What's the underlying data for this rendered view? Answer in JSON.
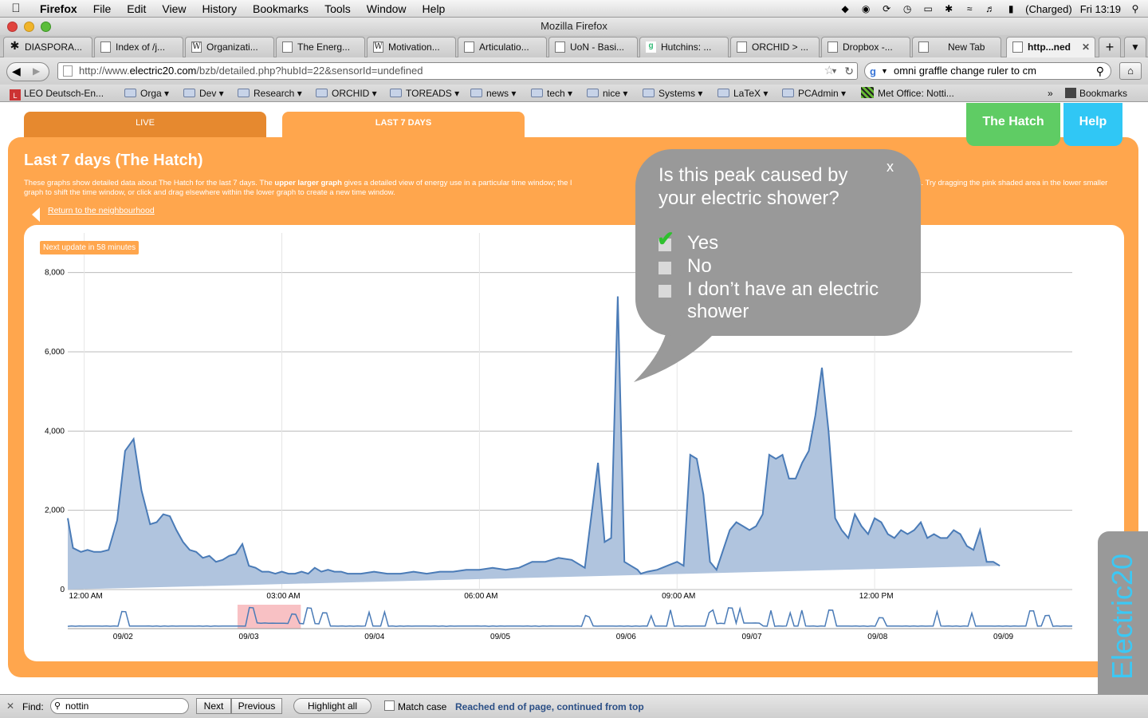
{
  "menubar": {
    "app": "Firefox",
    "items": [
      "File",
      "Edit",
      "View",
      "History",
      "Bookmarks",
      "Tools",
      "Window",
      "Help"
    ],
    "battery": "(Charged)",
    "clock": "Fri 13:19"
  },
  "window": {
    "title": "Mozilla Firefox"
  },
  "tabs": [
    {
      "label": "DIASPORA...",
      "icon": "asterisk-icon"
    },
    {
      "label": "Index of /j...",
      "icon": "page-icon"
    },
    {
      "label": "Organizati...",
      "icon": "wikipedia-icon"
    },
    {
      "label": "The Energ...",
      "icon": "page-icon"
    },
    {
      "label": "Motivation...",
      "icon": "wikipedia-icon"
    },
    {
      "label": "Articulatio...",
      "icon": "page-icon"
    },
    {
      "label": "UoN - Basi...",
      "icon": "page-icon"
    },
    {
      "label": "Hutchins: ...",
      "icon": "google-icon"
    },
    {
      "label": "ORCHID > ...",
      "icon": "page-icon"
    },
    {
      "label": "Dropbox -...",
      "icon": "page-icon"
    },
    {
      "label": "New Tab",
      "icon": "page-icon"
    },
    {
      "label": "http...ned",
      "icon": "page-icon"
    }
  ],
  "nav": {
    "url_prefix": "http://www.",
    "url_domain": "electric20.com",
    "url_rest": "/bzb/detailed.php?hubId=22&sensorId=undefined",
    "search": "omni graffle change ruler to cm"
  },
  "bookmarks": {
    "items": [
      "LEO Deutsch-En...",
      "Orga",
      "Dev",
      "Research",
      "ORCHID",
      "TOREADS",
      "news",
      "tech",
      "nice",
      "Systems",
      "LaTeX",
      "PCAdmin",
      "Met Office: Notti..."
    ],
    "overflow": "»",
    "menu": "Bookmarks"
  },
  "page": {
    "tab_live": "LIVE",
    "tab_last7": "LAST 7 DAYS",
    "hatch_button": "The Hatch",
    "help_button": "Help",
    "title": "Last 7 days (The Hatch)",
    "desc_pre": "These graphs show detailed data about The Hatch for the last 7 days. The ",
    "desc_bold": "upper larger graph",
    "desc_mid": " gives a detailed view of energy use in a particular time window; the l",
    "desc_end": "within the last 7 days. Try dragging the pink shaded area in the lower smaller graph to shift the time window, or click and drag elsewhere within the lower graph to create a new time window.",
    "back_link": "Return to the neighbourhood",
    "update_badge": "Next update in 58 minutes",
    "brand": "Electric20"
  },
  "popup": {
    "question": "Is this peak caused by your electric shower?",
    "close": "x",
    "options": [
      {
        "label": "Yes",
        "checked": true
      },
      {
        "label": "No",
        "checked": false
      },
      {
        "label": "I don’t have an electric shower",
        "checked": false
      }
    ]
  },
  "chart_data": [
    {
      "type": "area",
      "ylim": [
        0,
        9000
      ],
      "yticks": [
        "0",
        "2,000",
        "4,000",
        "6,000",
        "8,000"
      ],
      "ytick_values": [
        0,
        2000,
        4000,
        6000,
        8000
      ],
      "xticks": [
        "12:00 AM",
        "03:00 AM",
        "06:00 AM",
        "09:00 AM",
        "12:00 PM"
      ],
      "xtick_hours": [
        0,
        3,
        6,
        9,
        12
      ],
      "xlim_hours": [
        -0.25,
        15.0
      ],
      "color": "#4a7bb7",
      "fill": "#b0c4de",
      "x": [
        -0.25,
        -0.17,
        -0.05,
        0.05,
        0.15,
        0.25,
        0.37,
        0.5,
        0.62,
        0.75,
        0.87,
        1.0,
        1.1,
        1.2,
        1.3,
        1.4,
        1.5,
        1.6,
        1.7,
        1.8,
        1.9,
        2.0,
        2.1,
        2.2,
        2.3,
        2.4,
        2.5,
        2.6,
        2.7,
        2.8,
        2.9,
        3.0,
        3.1,
        3.2,
        3.3,
        3.4,
        3.5,
        3.6,
        3.7,
        3.8,
        3.9,
        4.0,
        4.2,
        4.4,
        4.6,
        4.8,
        5.0,
        5.2,
        5.4,
        5.6,
        5.8,
        6.0,
        6.2,
        6.4,
        6.6,
        6.8,
        7.0,
        7.2,
        7.4,
        7.6,
        7.8,
        7.9,
        8.0,
        8.1,
        8.2,
        8.3,
        8.4,
        8.45,
        8.55,
        8.7,
        8.85,
        9.0,
        9.1,
        9.2,
        9.3,
        9.4,
        9.5,
        9.6,
        9.7,
        9.8,
        9.9,
        10.0,
        10.1,
        10.2,
        10.3,
        10.4,
        10.5,
        10.6,
        10.7,
        10.8,
        10.9,
        11.0,
        11.1,
        11.2,
        11.3,
        11.4,
        11.5,
        11.6,
        11.7,
        11.8,
        11.9,
        12.0,
        12.1,
        12.2,
        12.3,
        12.4,
        12.5,
        12.6,
        12.7,
        12.8,
        12.9,
        13.0,
        13.1,
        13.2,
        13.3,
        13.4,
        13.5,
        13.6,
        13.7,
        13.8,
        13.9,
        14.0,
        14.1,
        14.2,
        14.3,
        14.4,
        14.5,
        14.6,
        14.7,
        14.8,
        14.9,
        15.0
      ],
      "y": [
        1800,
        1050,
        950,
        1000,
        950,
        950,
        1000,
        1750,
        3500,
        3800,
        2500,
        1650,
        1700,
        1900,
        1850,
        1500,
        1200,
        1000,
        950,
        800,
        850,
        700,
        750,
        850,
        900,
        1150,
        600,
        550,
        450,
        450,
        400,
        450,
        400,
        400,
        450,
        400,
        550,
        450,
        500,
        450,
        450,
        400,
        400,
        450,
        400,
        400,
        450,
        400,
        450,
        450,
        500,
        500,
        550,
        500,
        550,
        700,
        700,
        800,
        750,
        550,
        3200,
        1200,
        1300,
        7400,
        700,
        600,
        500,
        400,
        450,
        500,
        600,
        700,
        600,
        3400,
        3300,
        2400,
        700,
        500,
        1000,
        1500,
        1700,
        1600,
        1500,
        1600,
        1900,
        3400,
        3300,
        3400,
        2800,
        2800,
        3200,
        3500,
        4400,
        5600,
        4000,
        1800,
        1500,
        1300,
        1900,
        1600,
        1400,
        1800,
        1700,
        1400,
        1300,
        1500,
        1400,
        1500,
        1700,
        1300,
        1400,
        1300,
        1300,
        1500,
        1400,
        1100,
        1000,
        1500,
        700,
        700,
        600
      ]
    },
    {
      "type": "area",
      "xticks": [
        "09/02",
        "09/03",
        "09/04",
        "09/05",
        "09/06",
        "09/07",
        "09/08",
        "09/09"
      ],
      "selection": [
        0.169,
        0.232
      ],
      "color": "#4a7bb7"
    }
  ]
}
